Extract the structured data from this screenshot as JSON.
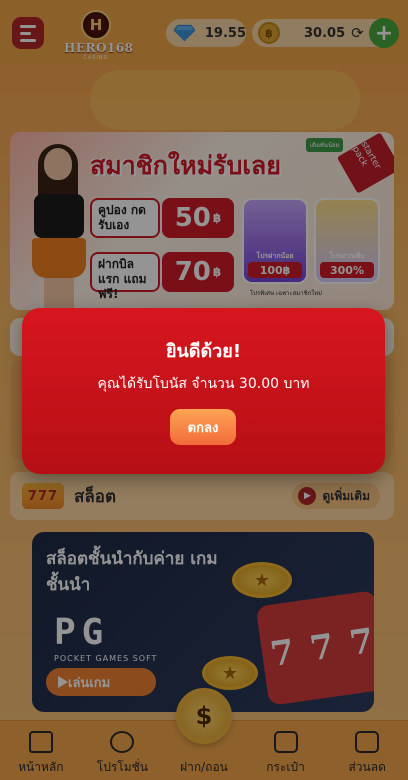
{
  "header": {
    "logo_text": "HERO168",
    "logo_sub": "CASINO",
    "diamond_balance": "19.55",
    "coin_balance": "30.05"
  },
  "banner": {
    "title": "สมาชิกใหม่รับเลย",
    "starter_tag": "starter pack",
    "new_tag": "เดิมพันน้อย",
    "offers": [
      {
        "label": "คูปอง กดรับเอง",
        "value": "50",
        "unit": "฿"
      },
      {
        "label": "ฝากบิลแรก แถมฟรี!",
        "value": "70",
        "unit": "฿"
      }
    ],
    "bonus_cards": [
      {
        "title": "โปรฝากน้อย",
        "value": "100฿"
      },
      {
        "title": "โปรฝากเพิ่ม",
        "value": "300%"
      }
    ],
    "note": "โปรพิเศษ เฉพาะสมาชิกใหม่"
  },
  "section": {
    "icon_text": "777",
    "title": "สล็อต",
    "see_more": "ดูเพิ่มเติม"
  },
  "provider": {
    "title": "สล็อตชั้นนำกับค่าย เกมชั้นนำ",
    "logo": "PG",
    "logo_sub": "POCKET GAMES SOFT",
    "play_label": "เล่นเกม"
  },
  "bottom_nav": [
    {
      "icon": "home-icon",
      "label": "หน้าหลัก"
    },
    {
      "icon": "promo-icon",
      "label": "โปรโมชั่น"
    },
    {
      "icon": "deposit-icon",
      "label": "ฝาก/ถอน"
    },
    {
      "icon": "wallet-icon",
      "label": "กระเป๋า"
    },
    {
      "icon": "discount-icon",
      "label": "ส่วนลด"
    }
  ],
  "modal": {
    "title": "ยินดีด้วย!",
    "message": "คุณได้รับโบนัส จำนวน 30.00 บาท",
    "confirm_label": "ตกลง"
  },
  "colors": {
    "modal_red": "#d7161e",
    "button_orange": "#f26b3a",
    "header_orange": "#f2a548",
    "add_green": "#4aa93e"
  }
}
